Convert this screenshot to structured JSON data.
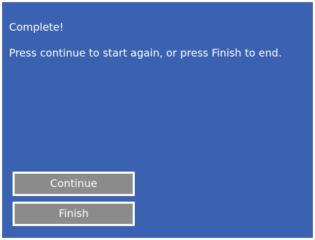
{
  "dialog": {
    "title": "Complete!",
    "message": "Press continue to start again, or press Finish to end.",
    "buttons": {
      "continue_label": "Continue",
      "finish_label": "Finish"
    },
    "colors": {
      "background": "#3b62b0",
      "button_fill": "#8b8b8b",
      "button_border": "#ffffff",
      "text": "#ffffff"
    }
  }
}
